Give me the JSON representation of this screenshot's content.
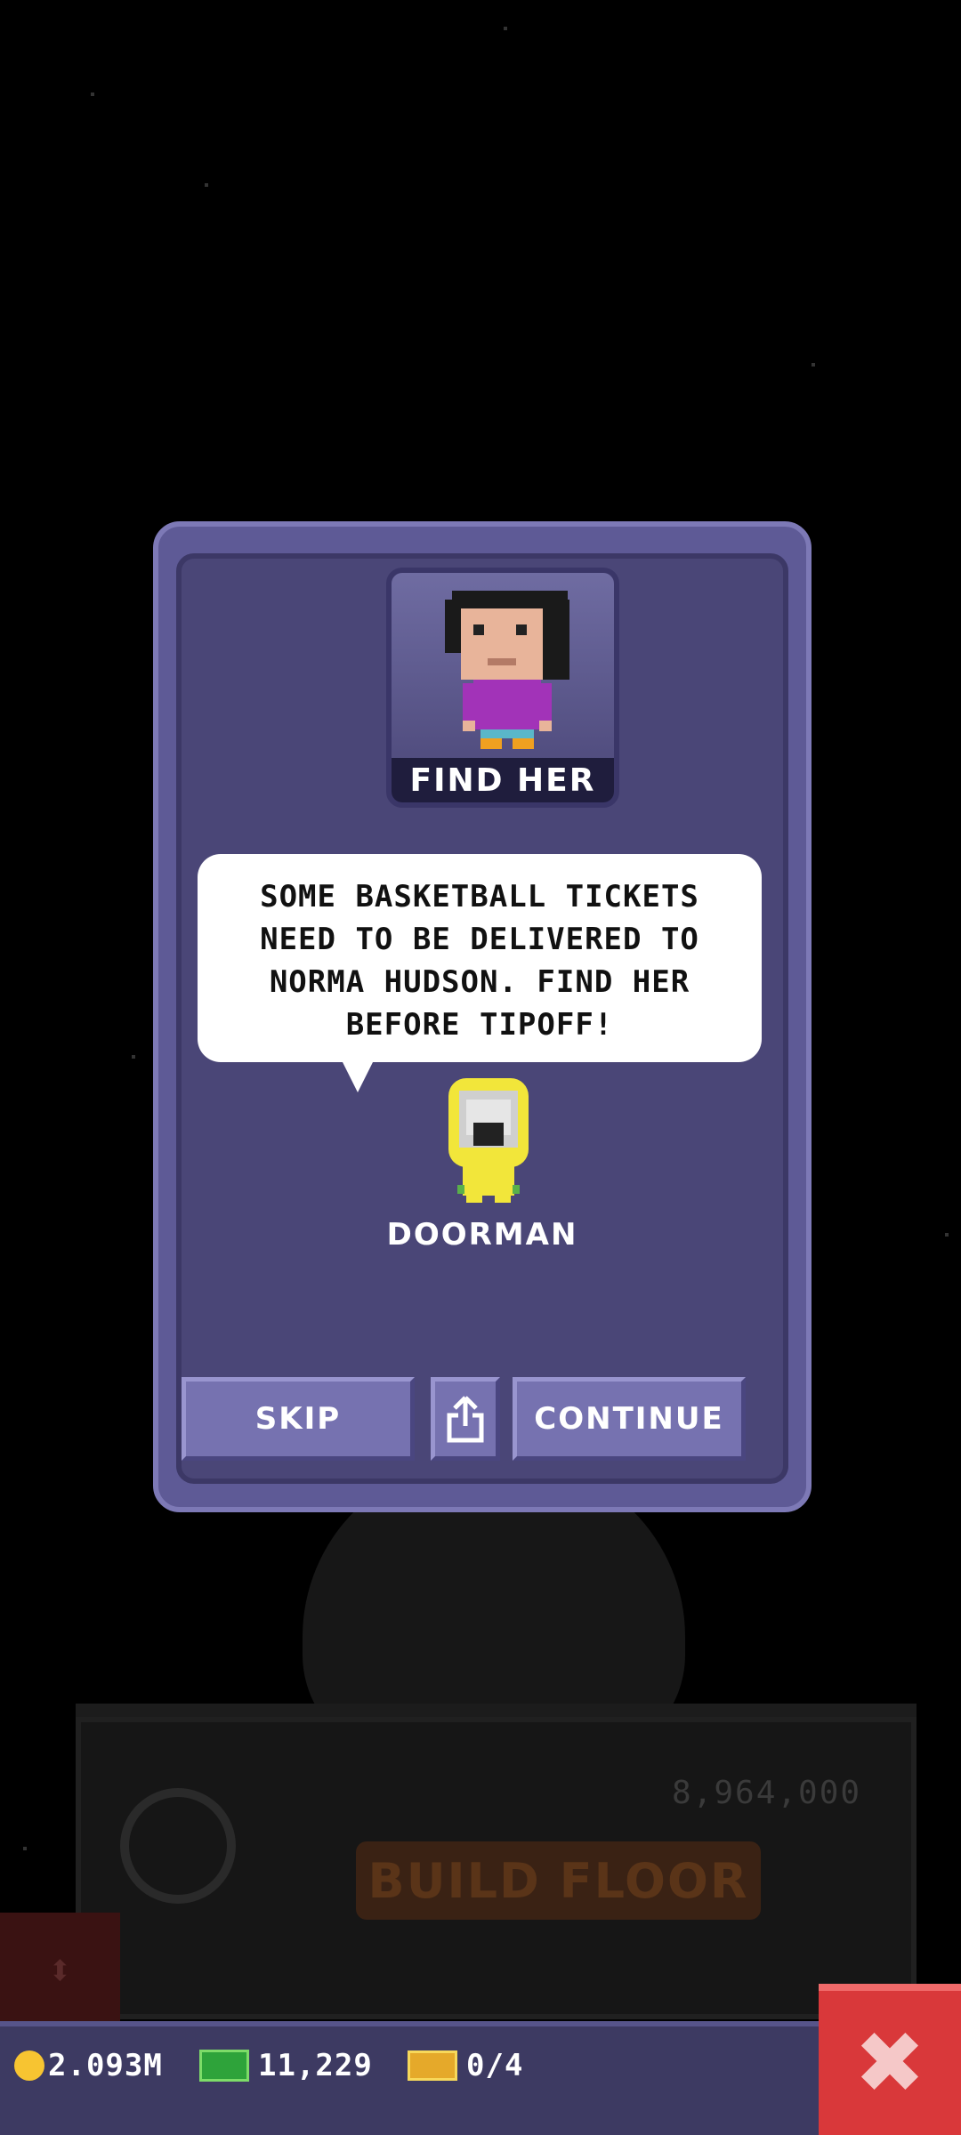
{
  "background": {
    "price": "8,964,000",
    "build_floor_label": "BUILD FLOOR"
  },
  "dialog": {
    "portrait_label": "FIND HER",
    "message": "SOME BASKETBALL TICKETS NEED TO BE DELIVERED TO NORMA HUDSON. FIND HER BEFORE TIPOFF!",
    "speaker": "DOORMAN",
    "skip_label": "SKIP",
    "share_icon": "share-icon",
    "continue_label": "CONTINUE"
  },
  "status": {
    "coins": "2.093M",
    "bux": "11,229",
    "tickets": "0/4",
    "close_icon": "close-icon"
  },
  "colors": {
    "panel": "#5e5a96",
    "panel_inner": "#4a4677",
    "button": "#7672b0",
    "close": "#d9383a"
  }
}
